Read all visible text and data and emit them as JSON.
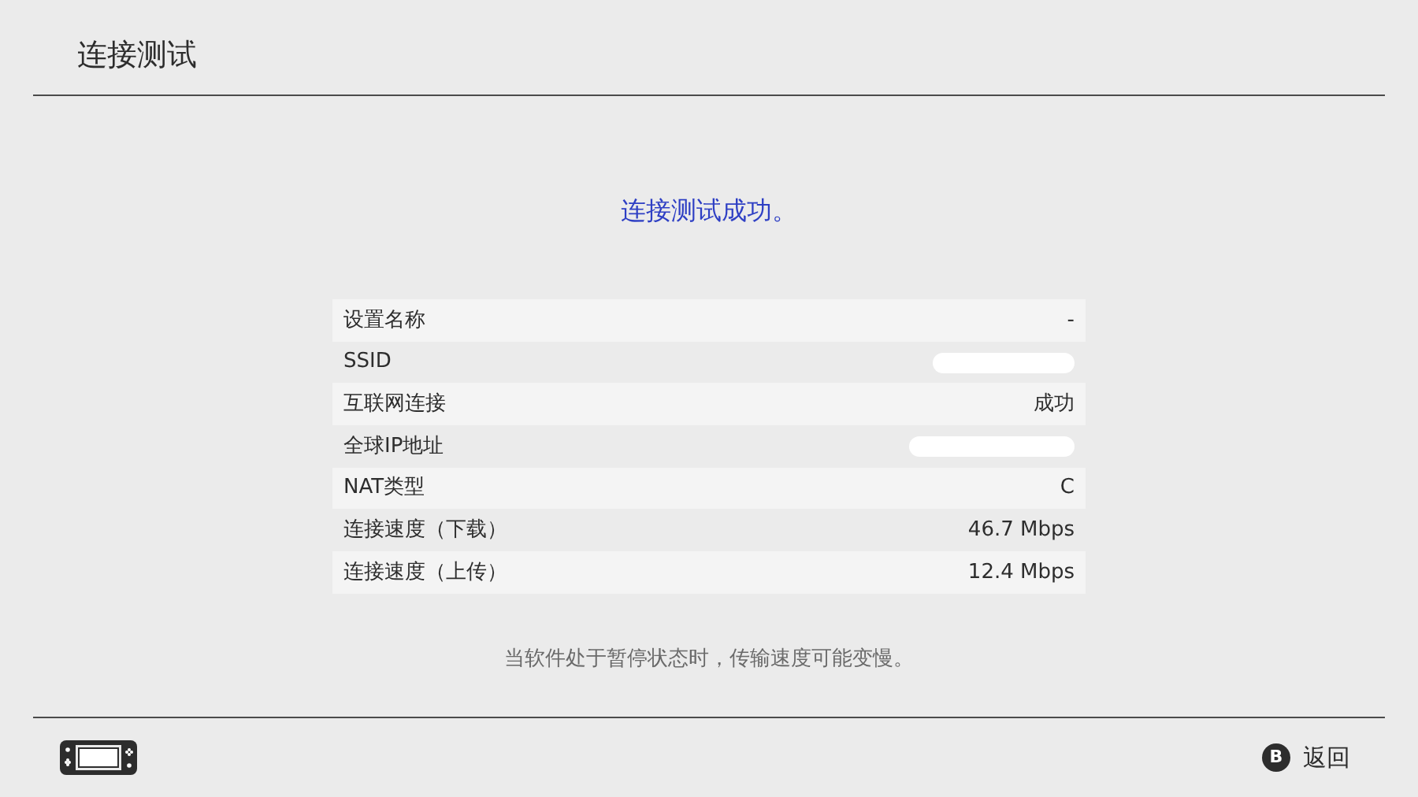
{
  "title": "连接测试",
  "result": "连接测试成功。",
  "rows": [
    {
      "label": "设置名称",
      "kind": "text",
      "value": "-"
    },
    {
      "label": "SSID",
      "kind": "hidden"
    },
    {
      "label": "互联网连接",
      "kind": "text",
      "value": "成功"
    },
    {
      "label": "全球IP地址",
      "kind": "hidden"
    },
    {
      "label": "NAT类型",
      "kind": "text",
      "value": "C"
    },
    {
      "label": "连接速度（下载）",
      "kind": "text",
      "value": "46.7 Mbps"
    },
    {
      "label": "连接速度（上传）",
      "kind": "text",
      "value": "12.4 Mbps"
    }
  ],
  "note": "当软件处于暂停状态时，传输速度可能变慢。",
  "footer": {
    "button_glyph": "B",
    "button_label": "返回"
  }
}
